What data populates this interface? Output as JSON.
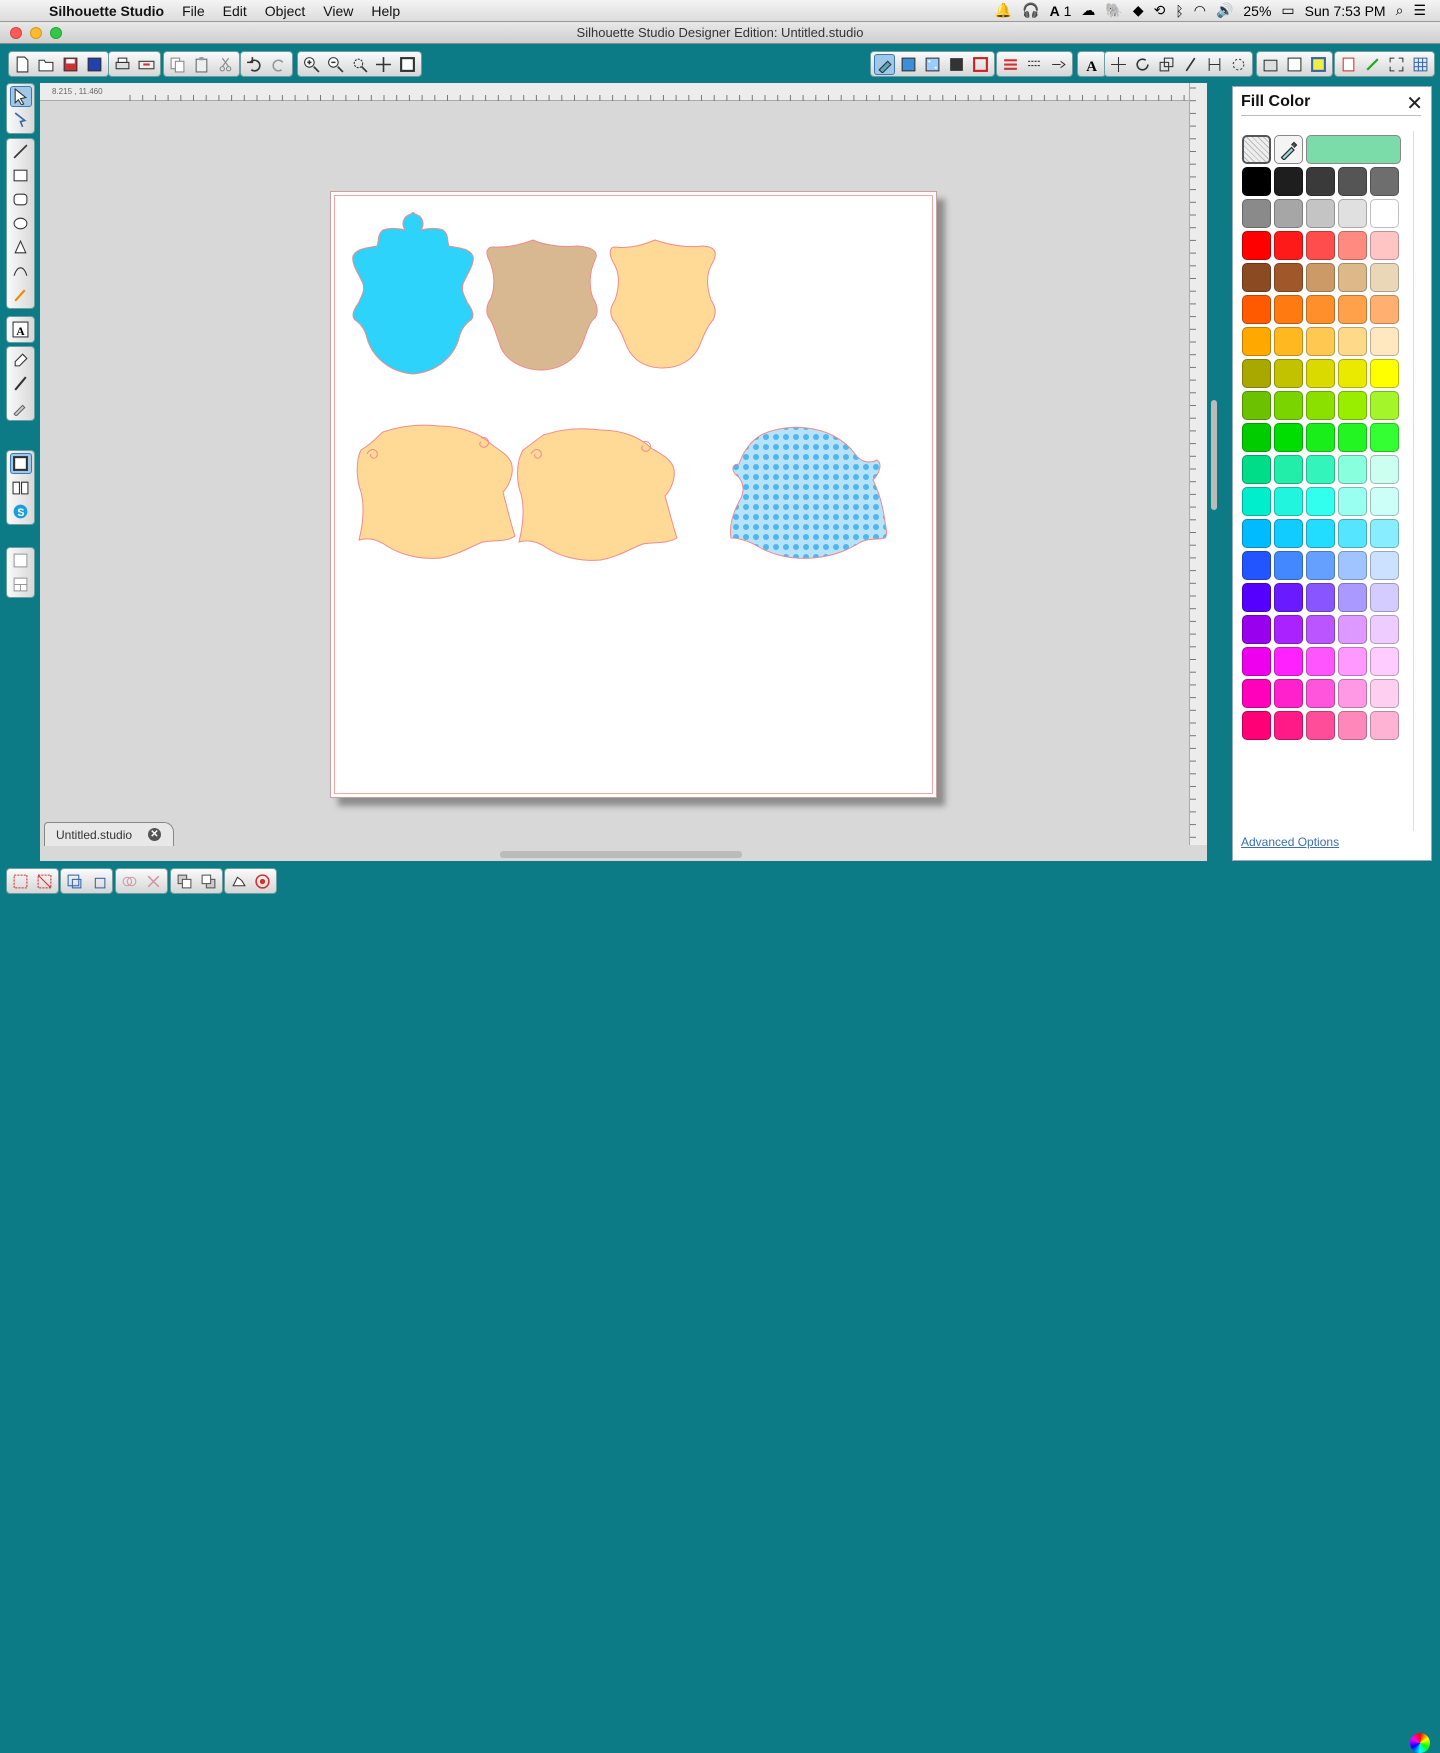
{
  "menubar": {
    "app_name": "Silhouette Studio",
    "items": [
      "File",
      "Edit",
      "Object",
      "View",
      "Help"
    ],
    "status": {
      "adobe_badge": "1",
      "battery": "25%",
      "clock": "Sun 7:53 PM"
    }
  },
  "window": {
    "title": "Silhouette Studio Designer Edition: Untitled.studio"
  },
  "ruler": {
    "coords": "8.215 , 11.460"
  },
  "document_tab": {
    "label": "Untitled.studio"
  },
  "panel": {
    "title": "Fill Color",
    "current_color": "#7bdcaa",
    "advanced_link": "Advanced Options",
    "swatches": [
      [
        "#000000",
        "#1e1e1e",
        "#3a3a3a",
        "#555555",
        "#6e6e6e"
      ],
      [
        "#8a8a8a",
        "#a6a6a6",
        "#c4c4c4",
        "#e0e0e0",
        "#ffffff"
      ],
      [
        "#ff0000",
        "#ff1a1a",
        "#ff4d4d",
        "#ff8a80",
        "#ffc4c4"
      ],
      [
        "#8b4a22",
        "#a0582a",
        "#cc9a66",
        "#ddb98a",
        "#ead7b8"
      ],
      [
        "#ff5a00",
        "#ff7a10",
        "#ff8f2a",
        "#ffa04a",
        "#ffb070"
      ],
      [
        "#ffa800",
        "#ffb820",
        "#ffc850",
        "#ffd98a",
        "#ffe7bf"
      ],
      [
        "#a8a800",
        "#c2c200",
        "#dada00",
        "#eaea00",
        "#ffff00"
      ],
      [
        "#6cc200",
        "#7ad400",
        "#8ce000",
        "#99ee00",
        "#a4f52a"
      ],
      [
        "#00cc00",
        "#00dd00",
        "#1aee1a",
        "#22f522",
        "#33ff33"
      ],
      [
        "#00dd88",
        "#22eeaa",
        "#33f5bb",
        "#88ffdd",
        "#ccfff0"
      ],
      [
        "#00eecc",
        "#22f5dd",
        "#33ffee",
        "#99fff0",
        "#ccfff8"
      ],
      [
        "#00bbff",
        "#10ccff",
        "#22ddff",
        "#55e5ff",
        "#88eeff"
      ],
      [
        "#2255ff",
        "#4488ff",
        "#66a0ff",
        "#a0c4ff",
        "#cce0ff"
      ],
      [
        "#5500ff",
        "#6a1aff",
        "#8855ff",
        "#aa99ff",
        "#d4ccff"
      ],
      [
        "#9900ee",
        "#aa22ff",
        "#bb55ff",
        "#dd99ff",
        "#eeccff"
      ],
      [
        "#ee00ee",
        "#ff22ff",
        "#ff55ff",
        "#ff99ff",
        "#ffccff"
      ],
      [
        "#ff00bb",
        "#ff22cc",
        "#ff55dd",
        "#ff99e5",
        "#ffcff2"
      ],
      [
        "#ff0077",
        "#ff1a88",
        "#ff4d99",
        "#ff88bb",
        "#ffb3d4"
      ]
    ]
  },
  "shapes": [
    {
      "id": "plaque-blue",
      "fill": "#2ed3fb"
    },
    {
      "id": "shield-tan",
      "fill": "#d8b891"
    },
    {
      "id": "shield-peach",
      "fill": "#ffd996"
    },
    {
      "id": "bracket-peach-1",
      "fill": "#ffd996"
    },
    {
      "id": "bracket-peach-2",
      "fill": "#ffd996"
    },
    {
      "id": "bracket-polka",
      "fill": "#b6e3fa"
    }
  ]
}
